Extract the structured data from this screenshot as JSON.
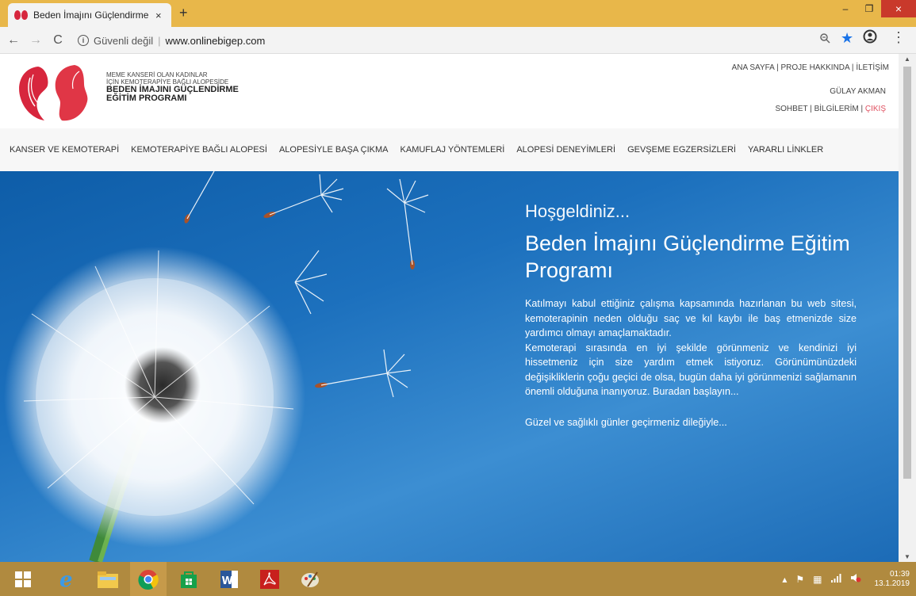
{
  "browser": {
    "tab_title": "Beden İmajını Güçlendirme Eğitin",
    "tab_close": "×",
    "new_tab": "+",
    "security_label": "Güvenli değil",
    "url": "www.onlinebigep.com",
    "window_controls": [
      "–",
      "❐",
      "×"
    ]
  },
  "site": {
    "logo": {
      "subtitle_line1": "MEME KANSERİ OLAN KADINLAR",
      "subtitle_line2": "İÇİN KEMOTERAPİYE BAĞLI ALOPESİDE",
      "title_line1": "BEDEN İMAJINI GÜÇLENDİRME",
      "title_line2": "EĞİTİM PROGRAMI"
    },
    "top_links": [
      "ANA SAYFA",
      "PROJE HAKKINDA",
      "İLETİŞİM"
    ],
    "user_name": "GÜLAY AKMAN",
    "user_links": {
      "chat": "SOHBET",
      "info": "BİLGİLERİM",
      "logout": "ÇIKIŞ"
    },
    "separator": " | ",
    "nav": [
      "KANSER VE KEMOTERAPİ",
      "KEMOTERAPİYE BAĞLI ALOPESİ",
      "ALOPESİYLE BAŞA ÇIKMA",
      "KAMUFLAJ YÖNTEMLERİ",
      "ALOPESİ DENEYİMLERİ",
      "GEVŞEME EGZERSİZLERİ",
      "YARARLI LİNKLER"
    ],
    "hero": {
      "welcome": "Hoşgeldiniz...",
      "title": "Beden İmajını Güçlendirme Eğitim Programı",
      "paragraph1": "Katılmayı kabul ettiğiniz çalışma kapsamında hazırlanan bu web sitesi, kemoterapinin neden olduğu saç ve kıl kaybı ile baş etmenizde size yardımcı olmayı amaçlamaktadır.",
      "paragraph2": "Kemoterapi sırasında en iyi şekilde görünmeniz ve kendinizi iyi hissetmeniz için size yardım etmek istiyoruz. Görünümünüzdeki değişikliklerin çoğu geçici de olsa, bugün daha iyi görünmenizi sağlamanın önemli olduğuna inanıyoruz. Buradan başlayın...",
      "closing": "Güzel ve sağlıklı günler geçirmeniz dileğiyle..."
    }
  },
  "taskbar": {
    "apps": [
      "windows-start",
      "internet-explorer",
      "file-explorer",
      "chrome",
      "store",
      "word",
      "acrobat",
      "paint"
    ],
    "time": "01:39",
    "date": "13.1.2019"
  },
  "colors": {
    "titlebar": "#e8b74a",
    "taskbar": "#b08a3f",
    "hero": "#1c70bd",
    "logo_red": "#d7263d",
    "logout_red": "#e05060"
  }
}
